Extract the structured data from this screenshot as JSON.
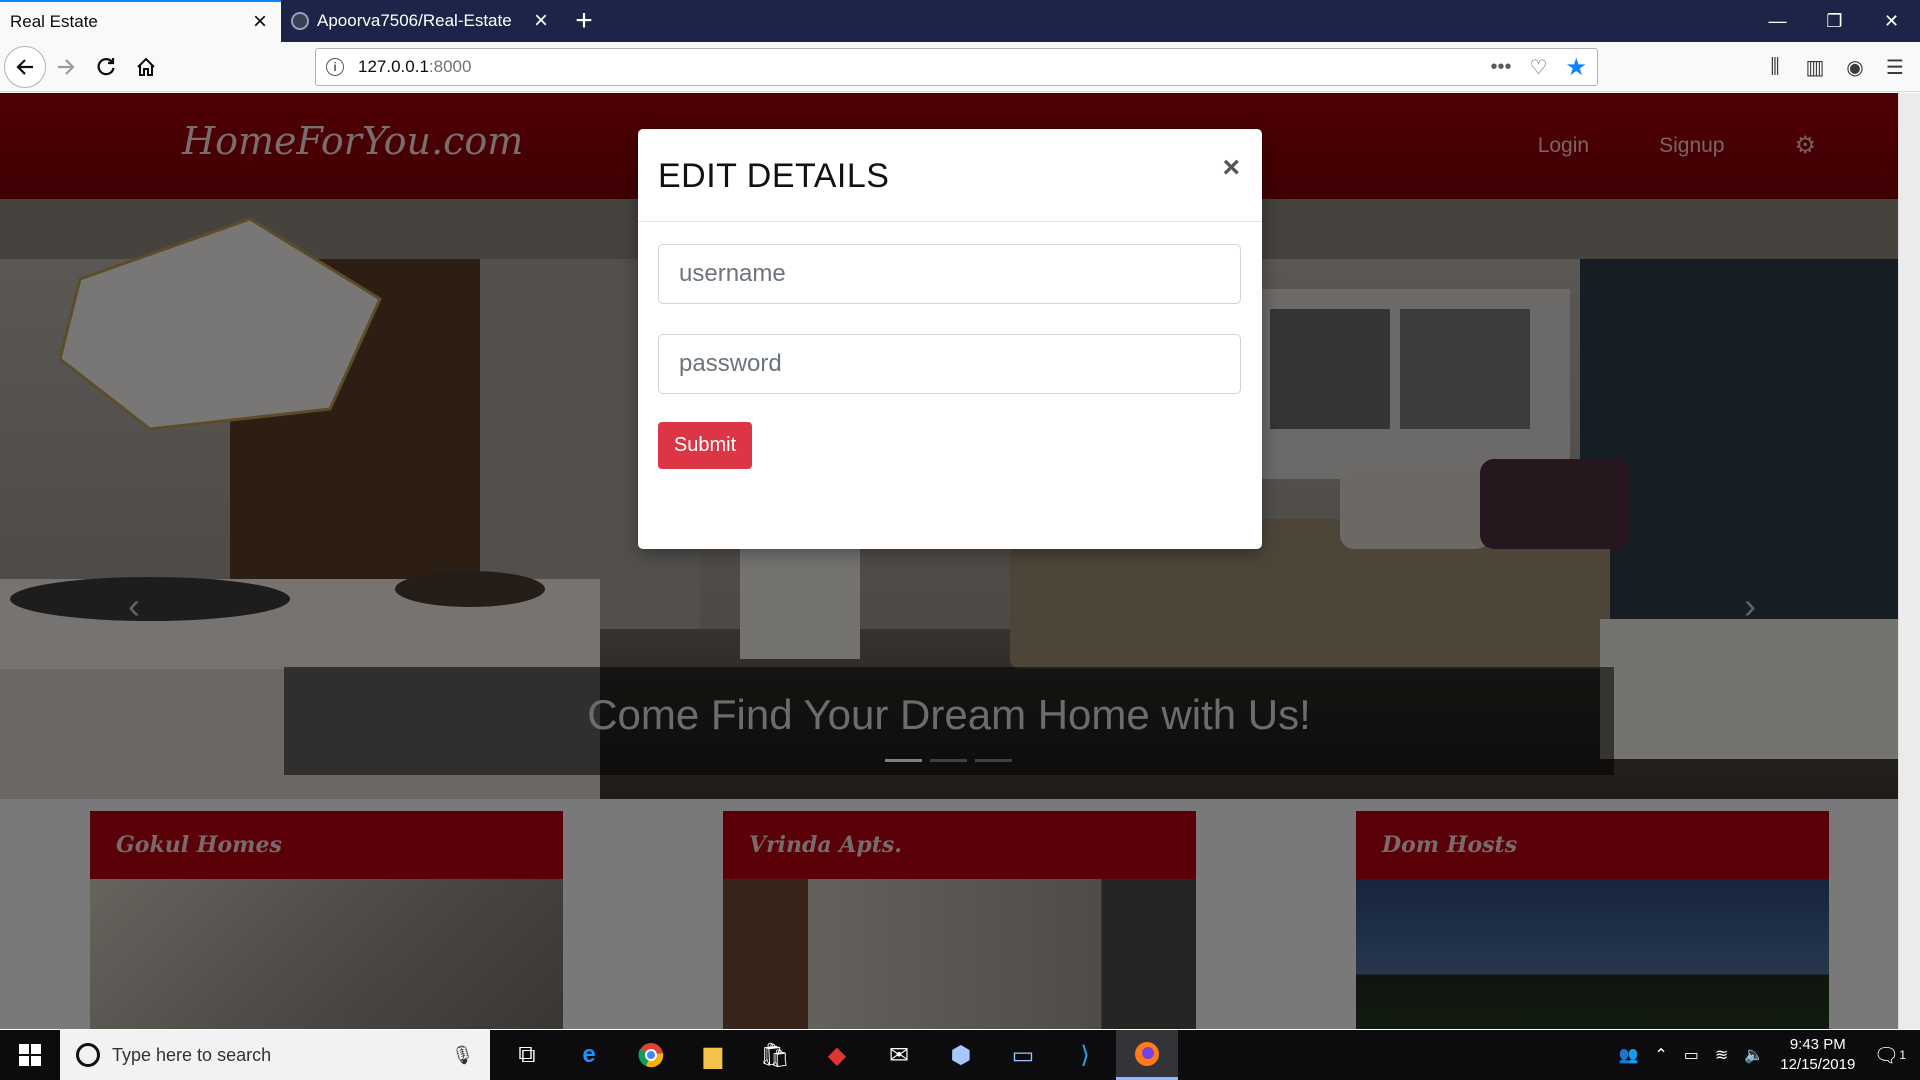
{
  "browser": {
    "tabs": [
      {
        "title": "Real Estate",
        "active": true
      },
      {
        "title": "Apoorva7506/Real-Estate",
        "active": false
      }
    ],
    "url_host": "127.0.0.1",
    "url_port": ":8000",
    "accent": "#0a84ff"
  },
  "site": {
    "brand": "HomeForYou.com",
    "nav": {
      "login": "Login",
      "signup": "Signup"
    },
    "header_color": "#8b0007",
    "hero_caption": "Come Find Your Dream Home with Us!",
    "cards": [
      {
        "title": "Gokul Homes"
      },
      {
        "title": "Vrinda Apts."
      },
      {
        "title": "Dom Hosts"
      }
    ]
  },
  "modal": {
    "title": "EDIT DETAILS",
    "close": "×",
    "username_placeholder": "username",
    "password_placeholder": "password",
    "submit_label": "Submit",
    "submit_color": "#dc3545"
  },
  "taskbar": {
    "search_placeholder": "Type here to search",
    "time": "9:43 PM",
    "date": "12/15/2019",
    "notification_count": "1"
  }
}
